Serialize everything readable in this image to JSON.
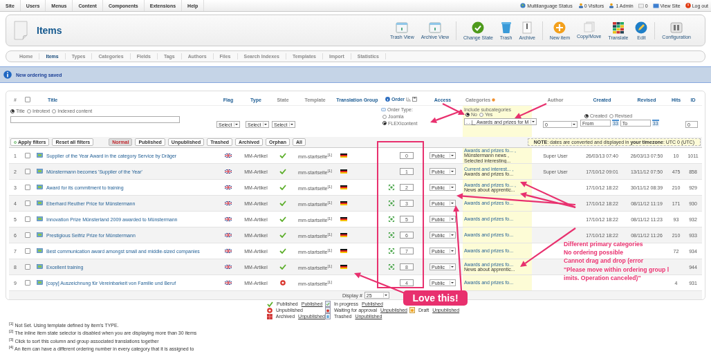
{
  "top_menu": {
    "items": [
      "Site",
      "Users",
      "Menus",
      "Content",
      "Components",
      "Extensions",
      "Help"
    ],
    "status": [
      {
        "kind": "globe",
        "label": "Multilanguage Status"
      },
      {
        "kind": "visitors",
        "label": "0 Visitors"
      },
      {
        "kind": "admin",
        "label": "1 Admin"
      },
      {
        "kind": "messages",
        "label": "0"
      },
      {
        "kind": "site",
        "label": "View Site"
      },
      {
        "kind": "logout",
        "label": "Log out"
      }
    ]
  },
  "header": {
    "title": "Items",
    "toolbar_groups": [
      {
        "buttons": [
          {
            "label": "Trash View"
          },
          {
            "label": "Archive View"
          }
        ]
      },
      {
        "buttons": [
          {
            "label": "Change State"
          },
          {
            "label": "Trash"
          },
          {
            "label": "Archive"
          }
        ]
      },
      {
        "buttons": [
          {
            "label": "New item"
          },
          {
            "label": "Copy/Move"
          },
          {
            "label": "Translate"
          },
          {
            "label": "Edit"
          }
        ]
      },
      {
        "buttons": [
          {
            "label": "Configuration"
          }
        ]
      }
    ]
  },
  "tabs": [
    {
      "label": "Home",
      "selected": false
    },
    {
      "label": "Items",
      "selected": true
    },
    {
      "label": "Types",
      "selected": false
    },
    {
      "label": "Categories",
      "selected": false
    },
    {
      "label": "Fields",
      "selected": false
    },
    {
      "label": "Tags",
      "selected": false
    },
    {
      "label": "Authors",
      "selected": false
    },
    {
      "label": "Files",
      "selected": false
    },
    {
      "label": "Search Indexes",
      "selected": false
    },
    {
      "label": "Templates",
      "selected": false
    },
    {
      "label": "Import",
      "selected": false
    },
    {
      "label": "Statistics",
      "selected": false
    }
  ],
  "message": "New ordering saved",
  "table": {
    "columns": [
      {
        "kind": "plain",
        "label": "#"
      },
      {
        "kind": "checkbox",
        "checked": false
      },
      {
        "kind": "blank"
      },
      {
        "kind": "plain",
        "label": "Title",
        "sortable": true
      },
      {
        "kind": "plain",
        "label": "Flag",
        "sortable": true
      },
      {
        "kind": "plain",
        "label": "Type",
        "sortable": true
      },
      {
        "kind": "plain",
        "label": "State",
        "sortable": false
      },
      {
        "kind": "plain",
        "label": "Template",
        "sortable": false
      },
      {
        "kind": "plain",
        "label": "Translation Group",
        "sortable": true
      },
      {
        "kind": "order",
        "label": "Order",
        "sortable": true
      },
      {
        "kind": "plain",
        "label": "Access",
        "sortable": true
      },
      {
        "kind": "categories",
        "label": "Categories",
        "sortable": false
      },
      {
        "kind": "plain",
        "label": "Author",
        "sortable": false
      },
      {
        "kind": "plain",
        "label": "Created",
        "sortable": true
      },
      {
        "kind": "plain",
        "label": "Revised",
        "sortable": true
      },
      {
        "kind": "plain",
        "label": "Hits",
        "sortable": true
      },
      {
        "kind": "plain",
        "label": "ID",
        "sortable": true
      }
    ],
    "filters": {
      "search_in": [
        {
          "label": "Title",
          "selected": true
        },
        {
          "label": "Introtext",
          "selected": false
        },
        {
          "label": "Indexed content",
          "selected": false
        }
      ],
      "flag_select": "Select",
      "type_select": "Select",
      "state_select": "Select",
      "order_type": {
        "label": "Order Type:",
        "options": [
          {
            "label": "Joomla",
            "selected": false
          },
          {
            "label": "FLEXIcontent",
            "selected": true
          }
        ]
      },
      "subcategories": {
        "label": "Include subcategories",
        "options": [
          {
            "label": "No",
            "selected": true
          },
          {
            "label": "Yes",
            "selected": false
          }
        ]
      },
      "category_select": ". . |_ Awards and prizes for M",
      "author_select": "0",
      "date_type": [
        {
          "label": "Created",
          "selected": true
        },
        {
          "label": "Revised",
          "selected": false
        }
      ],
      "from": {
        "placeholder": "From",
        "calendar": "33"
      },
      "to": {
        "placeholder": "To",
        "calendar": "33"
      },
      "id": "0"
    },
    "apply_button": "Apply filters",
    "reset_button": "Reset all filters",
    "state_buttons": [
      {
        "label": "Normal",
        "selected": true
      },
      {
        "label": "Published",
        "selected": false
      },
      {
        "label": "Unpublished",
        "selected": false
      },
      {
        "label": "Trashed",
        "selected": false
      },
      {
        "label": "Archived",
        "selected": false
      },
      {
        "label": "Orphan",
        "selected": false
      },
      {
        "label": "All",
        "selected": false
      }
    ],
    "note": "**NOTE**: dates are converted and displayed in **your timezone**: UTC 0 (UTC)",
    "rows": [
      {
        "number": "1",
        "checked": false,
        "title": "Supplier of the Year Award in the category Service by Dräger",
        "type": "MM-Artikel",
        "published": true,
        "template": "mm-startseite$^{[1]}$",
        "translation": true,
        "drag_handle": false,
        "order": "0",
        "access": "Public",
        "categories": [
          {
            "name": "Awards and prizes fo... ,",
            "primary": true
          },
          {
            "name": "Münstermann news ,",
            "primary": false
          },
          {
            "name": "Selected interesting...",
            "primary": false
          }
        ],
        "author": "Super User",
        "created": "26/03/13 07:40",
        "revised": "26/03/13 07:50",
        "hits": "10",
        "id": "1011"
      },
      {
        "number": "2",
        "checked": false,
        "title": "Münstermann becomes 'Supplier of the Year'",
        "type": "MM-Artikel",
        "published": true,
        "template": "mm-startseite$^{[1]}$",
        "translation": true,
        "drag_handle": false,
        "order": "1",
        "access": "Public",
        "categories": [
          {
            "name": "Current and interest... ,",
            "primary": true
          },
          {
            "name": "Awards and prizes fo...",
            "primary": false
          }
        ],
        "author": "Super User",
        "created": "17/10/12 09:01",
        "revised": "13/11/12 07:50",
        "hits": "475",
        "id": "858"
      },
      {
        "number": "3",
        "checked": false,
        "title": "Award for its commitment to training",
        "type": "MM-Artikel",
        "published": true,
        "template": "mm-startseite$^{[1]}$",
        "translation": true,
        "drag_handle": true,
        "order": "2",
        "access": "Public",
        "categories": [
          {
            "name": "Awards and prizes fo... ,",
            "primary": true
          },
          {
            "name": "News about apprentic...",
            "primary": false
          }
        ],
        "created": "17/10/12 18:22",
        "revised": "30/11/12 08:39",
        "hits": "210",
        "id": "929"
      },
      {
        "number": "4",
        "checked": false,
        "title": "Eberhard Reuther Price for Münstermann",
        "type": "MM-Artikel",
        "published": true,
        "template": "mm-startseite$^{[1]}$",
        "translation": true,
        "drag_handle": true,
        "order": "3",
        "access": "Public",
        "categories": [
          {
            "name": "Awards and prizes fo...",
            "primary": true
          }
        ],
        "created": "17/10/12 18:22",
        "revised": "08/11/12 11:19",
        "hits": "171",
        "id": "930"
      },
      {
        "number": "5",
        "checked": false,
        "title": "Innovation Prize Münsterland 2009 awarded to Münstermann",
        "type": "MM-Artikel",
        "published": true,
        "template": "mm-startseite$^{[1]}$",
        "translation": true,
        "drag_handle": true,
        "order": "5",
        "access": "Public",
        "categories": [
          {
            "name": "Awards and prizes fo...",
            "primary": true
          }
        ],
        "created": "17/10/12 18:22",
        "revised": "08/11/12 11:23",
        "hits": "93",
        "id": "932"
      },
      {
        "number": "6",
        "checked": false,
        "title": "Prestigious Seifriz Prize for Münstermann",
        "type": "MM-Artikel",
        "published": true,
        "template": "mm-startseite$^{[1]}$",
        "translation": true,
        "drag_handle": true,
        "order": "6",
        "access": "Public",
        "categories": [
          {
            "name": "Awards and prizes fo...",
            "primary": true
          }
        ],
        "created": "17/10/12 18:22",
        "revised": "08/11/12 11:26",
        "hits": "210",
        "id": "933"
      },
      {
        "number": "7",
        "checked": false,
        "title": "Best communication award amongst small and middle-sized companies",
        "type": "MM-Artikel",
        "published": true,
        "template": "mm-startseite$^{[1]}$",
        "translation": true,
        "drag_handle": true,
        "order": "7",
        "access": "Public",
        "categories": [
          {
            "name": "Awards and prizes fo...",
            "primary": true
          }
        ],
        "hits": "72",
        "id": "934"
      },
      {
        "number": "8",
        "checked": false,
        "title": "Excellent training",
        "type": "MM-Artikel",
        "published": true,
        "template": "mm-startseite$^{[1]}$",
        "translation": true,
        "drag_handle": true,
        "order": "8",
        "access": "Public",
        "categories": [
          {
            "name": "Awards and prizes fo...",
            "primary": true
          },
          {
            "name": "News about apprentic...",
            "primary": false
          }
        ],
        "id": "944"
      },
      {
        "number": "9",
        "checked": false,
        "title": "[copy] Auszeichnung für Vereinbarkeit von Familie und Beruf",
        "type": "MM-Artikel",
        "published": false,
        "template": "mm-startseite$^{[1]}$",
        "translation": false,
        "drag_handle": false,
        "order": "4",
        "access": "Public",
        "categories": [
          {
            "name": "Awards and prizes fo...",
            "primary": true
          }
        ],
        "hits": "4",
        "id": "931"
      }
    ],
    "display": {
      "label": "Display #",
      "value": "25"
    }
  },
  "legend_rows": [
    {
      "items": [
        {
          "kind": "published",
          "label": "Published",
          "link": "Published"
        },
        {
          "kind": "in_progress",
          "label": "In progress",
          "link": "Published"
        }
      ]
    },
    {
      "items": [
        {
          "kind": "unpublished",
          "label": "Unpublished"
        },
        {
          "kind": "waiting",
          "label": "Waiting for approval",
          "link": "Unpublished"
        },
        {
          "kind": "draft",
          "label": "Draft",
          "link": "Unpublished"
        }
      ]
    },
    {
      "items": [
        {
          "kind": "archived",
          "label": "Archived",
          "link": "Unpublished"
        },
        {
          "kind": "trashed",
          "label": "Trashed",
          "link": "Unpublished"
        }
      ]
    }
  ],
  "footnotes": [
    "$^{[1]}$ Not Set. Using template defined by item's TYPE.",
    "$^{[2]}$ The inline item state selector is disabled when you are displaying more than 30 items",
    "$^{[3]}$ Click to sort this column and group associated translations together",
    "$^{[4]}$ An item can have a different ordering number in every category that it is assigned to"
  ],
  "annotations": {
    "callout": "Love this!",
    "note_lines": [
      "Different primary categories",
      "No ordering possible",
      "Cannot drag and drop (error",
      "\"Please move within ordering group l",
      "imits. Operation canceled)\""
    ]
  }
}
